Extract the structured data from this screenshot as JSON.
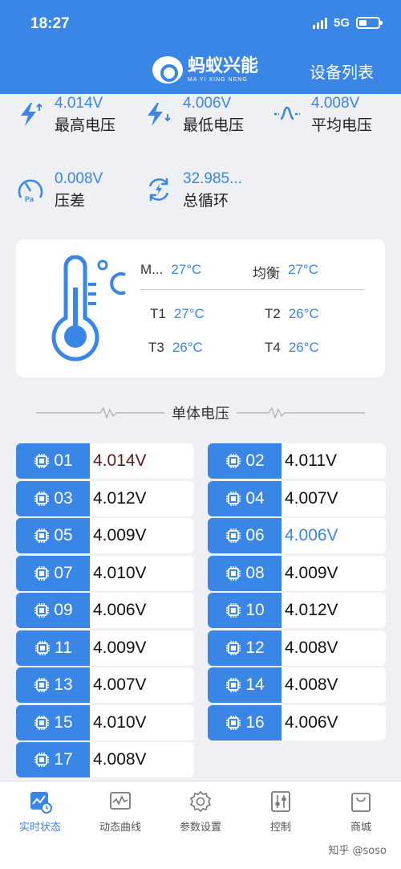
{
  "status_bar": {
    "time": "18:27",
    "network": "5G"
  },
  "header": {
    "brand_cn": "蚂蚁兴能",
    "brand_en": "MA YI XING NENG",
    "device_list": "设备列表"
  },
  "stats": [
    {
      "value": "4.014V",
      "label": "最高电压",
      "icon": "bolt-up-icon"
    },
    {
      "value": "4.006V",
      "label": "最低电压",
      "icon": "bolt-down-icon"
    },
    {
      "value": "4.008V",
      "label": "平均电压",
      "icon": "average-wave-icon"
    },
    {
      "value": "0.008V",
      "label": "压差",
      "icon": "pressure-gauge-icon"
    },
    {
      "value": "32.985...",
      "label": "总循环",
      "icon": "cycle-icon"
    }
  ],
  "temperature": {
    "items": [
      {
        "label": "M...",
        "value": "27°C"
      },
      {
        "label": "均衡",
        "value": "27°C"
      },
      {
        "label": "T1",
        "value": "27°C"
      },
      {
        "label": "T2",
        "value": "26°C"
      },
      {
        "label": "T3",
        "value": "26°C"
      },
      {
        "label": "T4",
        "value": "26°C"
      }
    ]
  },
  "cells_section_title": "单体电压",
  "cells": [
    {
      "id": "01",
      "voltage": "4.014V",
      "color": "#5a1a1a"
    },
    {
      "id": "02",
      "voltage": "4.011V",
      "color": "#111111"
    },
    {
      "id": "03",
      "voltage": "4.012V",
      "color": "#111111"
    },
    {
      "id": "04",
      "voltage": "4.007V",
      "color": "#111111"
    },
    {
      "id": "05",
      "voltage": "4.009V",
      "color": "#111111"
    },
    {
      "id": "06",
      "voltage": "4.006V",
      "color": "#3a86e6"
    },
    {
      "id": "07",
      "voltage": "4.010V",
      "color": "#111111"
    },
    {
      "id": "08",
      "voltage": "4.009V",
      "color": "#111111"
    },
    {
      "id": "09",
      "voltage": "4.006V",
      "color": "#111111"
    },
    {
      "id": "10",
      "voltage": "4.012V",
      "color": "#111111"
    },
    {
      "id": "11",
      "voltage": "4.009V",
      "color": "#111111"
    },
    {
      "id": "12",
      "voltage": "4.008V",
      "color": "#111111"
    },
    {
      "id": "13",
      "voltage": "4.007V",
      "color": "#111111"
    },
    {
      "id": "14",
      "voltage": "4.008V",
      "color": "#111111"
    },
    {
      "id": "15",
      "voltage": "4.010V",
      "color": "#111111"
    },
    {
      "id": "16",
      "voltage": "4.006V",
      "color": "#111111"
    },
    {
      "id": "17",
      "voltage": "4.008V",
      "color": "#111111"
    }
  ],
  "nav": [
    {
      "label": "实时状态",
      "icon": "realtime-icon",
      "active": true
    },
    {
      "label": "动态曲线",
      "icon": "chart-curve-icon",
      "active": false
    },
    {
      "label": "参数设置",
      "icon": "gear-icon",
      "active": false
    },
    {
      "label": "控制",
      "icon": "control-sliders-icon",
      "active": false
    },
    {
      "label": "商城",
      "icon": "shop-bag-icon",
      "active": false
    }
  ],
  "watermark": "知乎 @soso"
}
